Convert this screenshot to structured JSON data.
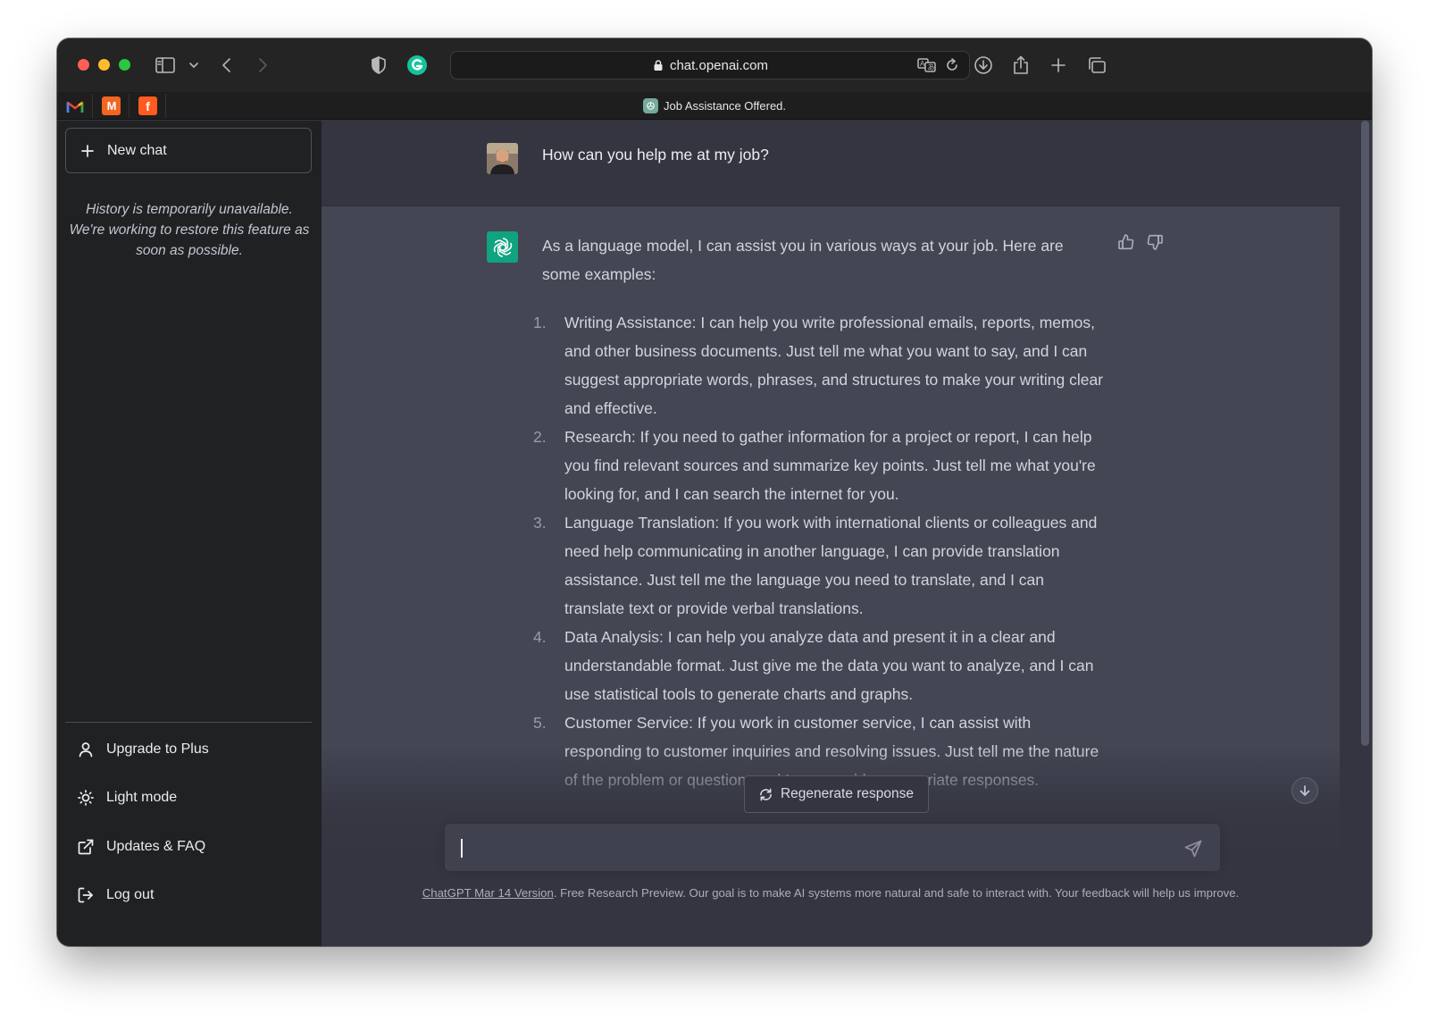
{
  "browser": {
    "url": "chat.openai.com",
    "tab_title": "Job Assistance Offered.",
    "favorites": [
      {
        "letter": "M",
        "color": "#ea4335"
      },
      {
        "letter": "M",
        "color": "#f26522"
      },
      {
        "letter": "f",
        "color": "#ff5a1f"
      }
    ]
  },
  "sidebar": {
    "new_chat": "New chat",
    "history_note": "History is temporarily unavailable. We're working to restore this feature as soon as possible.",
    "items": [
      {
        "label": "Upgrade to Plus",
        "icon": "user-icon"
      },
      {
        "label": "Light mode",
        "icon": "sun-icon"
      },
      {
        "label": "Updates & FAQ",
        "icon": "external-link-icon"
      },
      {
        "label": "Log out",
        "icon": "logout-icon"
      }
    ]
  },
  "conversation": {
    "user_message": "How can you help me at my job?",
    "assistant_intro": "As a language model, I can assist you in various ways at your job. Here are some examples:",
    "assistant_list": [
      {
        "num": "1.",
        "text": "Writing Assistance: I can help you write professional emails, reports, memos, and other business documents. Just tell me what you want to say, and I can suggest appropriate words, phrases, and structures to make your writing clear and effective."
      },
      {
        "num": "2.",
        "text": "Research: If you need to gather information for a project or report, I can help you find relevant sources and summarize key points. Just tell me what you're looking for, and I can search the internet for you."
      },
      {
        "num": "3.",
        "text": "Language Translation: If you work with international clients or colleagues and need help communicating in another language, I can provide translation assistance. Just tell me the language you need to translate, and I can translate text or provide verbal translations."
      },
      {
        "num": "4.",
        "text": "Data Analysis: I can help you analyze data and present it in a clear and understandable format. Just give me the data you want to analyze, and I can use statistical tools to generate charts and graphs."
      },
      {
        "num": "5.",
        "text": "Customer Service: If you work in customer service, I can assist with responding to customer inquiries and resolving issues. Just tell me the nature of the problem or question, and I can provide appropriate responses."
      }
    ]
  },
  "composer": {
    "regenerate": "Regenerate response",
    "value": ""
  },
  "footer": {
    "link": "ChatGPT Mar 14 Version",
    "text": ". Free Research Preview. Our goal is to make AI systems more natural and safe to interact with. Your feedback will help us improve."
  },
  "colors": {
    "accent": "#10a37f",
    "sidebar_bg": "#202123",
    "main_bg": "#343541",
    "assistant_bg": "#444654"
  }
}
